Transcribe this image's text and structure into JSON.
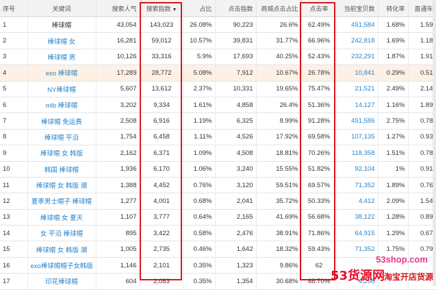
{
  "header": {
    "cols": [
      "序号",
      "关键词",
      "搜索人气",
      "搜索指数",
      "占比",
      "点击指数",
      "商城点击占比",
      "点击率",
      "当前宝贝数",
      "转化率",
      "直通车"
    ],
    "sort_arrow": "▼"
  },
  "rows": [
    {
      "no": "1",
      "kw": "棒球帽",
      "pop": "43,054",
      "idx": "143,023",
      "share": "26.08%",
      "click": "90,223",
      "mall": "26.6%",
      "ctr": "62.49%",
      "items": "451,584",
      "cvr": "1.68%",
      "ztc": "1.59"
    },
    {
      "no": "2",
      "kw": "棒球帽 女",
      "pop": "16,281",
      "idx": "59,012",
      "share": "10.57%",
      "click": "39,831",
      "mall": "31.77%",
      "ctr": "66.96%",
      "items": "242,818",
      "cvr": "1.69%",
      "ztc": "1.18"
    },
    {
      "no": "3",
      "kw": "棒球帽 男",
      "pop": "10,126",
      "idx": "33,316",
      "share": "5.9%",
      "click": "17,693",
      "mall": "40.25%",
      "ctr": "52.43%",
      "items": "232,291",
      "cvr": "1.87%",
      "ztc": "1.91"
    },
    {
      "no": "4",
      "kw": "exo 棒球帽",
      "pop": "17,289",
      "idx": "28,772",
      "share": "5.08%",
      "click": "7,912",
      "mall": "10.67%",
      "ctr": "26.78%",
      "items": "10,841",
      "cvr": "0.29%",
      "ztc": "0.51"
    },
    {
      "no": "5",
      "kw": "NY棒球帽",
      "pop": "5,607",
      "idx": "13,612",
      "share": "2.37%",
      "click": "10,331",
      "mall": "19.65%",
      "ctr": "75.47%",
      "items": "21,521",
      "cvr": "2.49%",
      "ztc": "2.14"
    },
    {
      "no": "6",
      "kw": "mlb 棒球帽",
      "pop": "3,202",
      "idx": "9,334",
      "share": "1.61%",
      "click": "4,858",
      "mall": "26.4%",
      "ctr": "51.36%",
      "items": "14,127",
      "cvr": "1.16%",
      "ztc": "1.89"
    },
    {
      "no": "7",
      "kw": "棒球帽 免运费",
      "pop": "2,508",
      "idx": "6,916",
      "share": "1.19%",
      "click": "6,325",
      "mall": "8.99%",
      "ctr": "91.28%",
      "items": "451,586",
      "cvr": "2.75%",
      "ztc": "0.78"
    },
    {
      "no": "8",
      "kw": "棒球帽 平沿",
      "pop": "1,754",
      "idx": "6,458",
      "share": "1.11%",
      "click": "4,526",
      "mall": "17.92%",
      "ctr": "69.58%",
      "items": "107,135",
      "cvr": "1.27%",
      "ztc": "0.93"
    },
    {
      "no": "9",
      "kw": "棒球帽 女 韩版",
      "pop": "2,162",
      "idx": "6,371",
      "share": "1.09%",
      "click": "4,508",
      "mall": "18.81%",
      "ctr": "70.26%",
      "items": "118,358",
      "cvr": "1.51%",
      "ztc": "0.78"
    },
    {
      "no": "10",
      "kw": "韩国 棒球帽",
      "pop": "1,936",
      "idx": "6,170",
      "share": "1.06%",
      "click": "3,240",
      "mall": "15.55%",
      "ctr": "51.82%",
      "items": "92,104",
      "cvr": "1%",
      "ztc": "0.91"
    },
    {
      "no": "11",
      "kw": "棒球帽 女 韩版 潮",
      "pop": "1,388",
      "idx": "4,452",
      "share": "0.76%",
      "click": "3,120",
      "mall": "59.51%",
      "ctr": "69.57%",
      "items": "71,352",
      "cvr": "1.89%",
      "ztc": "0.76"
    },
    {
      "no": "12",
      "kw": "夏季男士帽子 棒球帽",
      "pop": "1,277",
      "idx": "4,001",
      "share": "0.68%",
      "click": "2,041",
      "mall": "35.72%",
      "ctr": "50.33%",
      "items": "4,412",
      "cvr": "2.09%",
      "ztc": "1.54"
    },
    {
      "no": "13",
      "kw": "棒球帽 女 夏天",
      "pop": "1,107",
      "idx": "3,777",
      "share": "0.64%",
      "click": "2,165",
      "mall": "41.69%",
      "ctr": "56.68%",
      "items": "38,122",
      "cvr": "1.28%",
      "ztc": "0.89"
    },
    {
      "no": "14",
      "kw": "女 平沿 棒球帽",
      "pop": "895",
      "idx": "3,422",
      "share": "0.58%",
      "click": "2,476",
      "mall": "38.91%",
      "ctr": "71.86%",
      "items": "64,915",
      "cvr": "1.29%",
      "ztc": "0.67"
    },
    {
      "no": "15",
      "kw": "棒球帽 女 韩版 潮",
      "pop": "1,005",
      "idx": "2,735",
      "share": "0.46%",
      "click": "1,642",
      "mall": "18.32%",
      "ctr": "59.43%",
      "items": "71,352",
      "cvr": "1.75%",
      "ztc": "0.79"
    },
    {
      "no": "16",
      "kw": "exo棒球帽帽子女韩版",
      "pop": "1,146",
      "idx": "2,101",
      "share": "0.35%",
      "click": "1,323",
      "mall": "9.86%",
      "ctr": "62",
      "items": "",
      "cvr": "",
      "ztc": ""
    },
    {
      "no": "17",
      "kw": "印花棒球帽",
      "pop": "604",
      "idx": "2,083",
      "share": "0.35%",
      "click": "1,354",
      "mall": "30.68%",
      "ctr": "88.70%",
      "items": "4,298",
      "cvr": "",
      "ztc": ""
    }
  ],
  "watermark": {
    "site": "53shop.com",
    "brand": "53货源网",
    "shop": "淘宝开店货源"
  }
}
